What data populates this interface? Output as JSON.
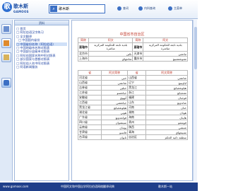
{
  "header": {
    "logo_mark": "歌",
    "logo_text": "歌木斯",
    "logo_sub": "GAMOOS",
    "search_value": "歌木斯",
    "links": [
      "查词",
      "内科查询",
      "主菜单"
    ]
  },
  "toc": {
    "title": "资料",
    "items": [
      {
        "label": "□ 首页",
        "sub": false
      },
      {
        "label": "□ 阿拉伯语汉字练习",
        "sub": false
      },
      {
        "label": "□ 全文翻译",
        "sub": false
      },
      {
        "label": "□ 中国国内省份",
        "sub": true
      },
      {
        "label": "□ 中国省份名称（阿拉伯语）",
        "sub": false
      },
      {
        "label": "□ 中国地级市名称对照表",
        "sub": false
      },
      {
        "label": "□ 中国部分县级市对照表",
        "sub": false
      },
      {
        "label": "□ 阿拉伯国家名称中阿对照表",
        "sub": false
      },
      {
        "label": "□ 部分国家与首都对照表",
        "sub": false
      },
      {
        "label": "□ 阿拉伯人名中阿对照表",
        "sub": false
      },
      {
        "label": "□ 阿语新闻服务",
        "sub": false
      }
    ]
  },
  "content": {
    "title": "中国省市自治区",
    "table1": {
      "headers": [
        "简称",
        "阿文",
        "简称",
        "阿文"
      ],
      "rows": [
        [
          "直辖市",
          "بلدية تابعة للحكومة المركزية مباشرة",
          "直辖市",
          "بلدية تابعة للحكومة المركزية مباشرة"
        ],
        [
          "北京市",
          "بكين",
          "天津市",
          "تيانجين"
        ],
        [
          "上海市",
          "شانغهاي",
          "重庆市",
          "تشونغتشينغ"
        ]
      ]
    },
    "table2": {
      "headers": [
        "省",
        "阿文简称",
        "省",
        "阿文简称"
      ],
      "rows": [
        [
          "河北省",
          "خبي",
          "山西省",
          "شانشي"
        ],
        [
          "山西省",
          "شانشي",
          "辽宁",
          "لياونينغ"
        ],
        [
          "吉林省",
          "جيلين",
          "黑龙江",
          "هيلونغجيانغ"
        ],
        [
          "江苏省",
          "جيانغسو",
          "浙江",
          "تشجيانغ"
        ],
        [
          "安徽省",
          "آنهوي",
          "福建",
          "فوجيان"
        ],
        [
          "江西省",
          "جيانغشي",
          "山东",
          "شاندونغ"
        ],
        [
          "黑龙江省",
          "هيلونغجيانغ",
          "河南",
          "خنان"
        ],
        [
          "湖北省",
          "هوبي",
          "湖南",
          "هونان"
        ],
        [
          "广东省",
          "قوانغدونغ",
          "海南",
          "هاينان"
        ],
        [
          "四川省",
          "سيتشوان",
          "贵州",
          "قويتشو"
        ],
        [
          "云南省",
          "يوننان",
          "陕西",
          "شنشي"
        ],
        [
          "甘肃省",
          "قانسو",
          "青海",
          "تشينغهاي"
        ],
        [
          "台湾省",
          "تايوان",
          "自治区",
          "منطقة ذاتية الحكم"
        ]
      ]
    }
  },
  "status": {
    "left": "www.gamoos.com",
    "middle": "中国阿文和中国自学阿拉伯语网络翻译词典",
    "right": "歌木斯一站"
  },
  "colors": {
    "accent": "#1f3f8a",
    "title": "#c0392b",
    "link": "#1a3fa0"
  }
}
